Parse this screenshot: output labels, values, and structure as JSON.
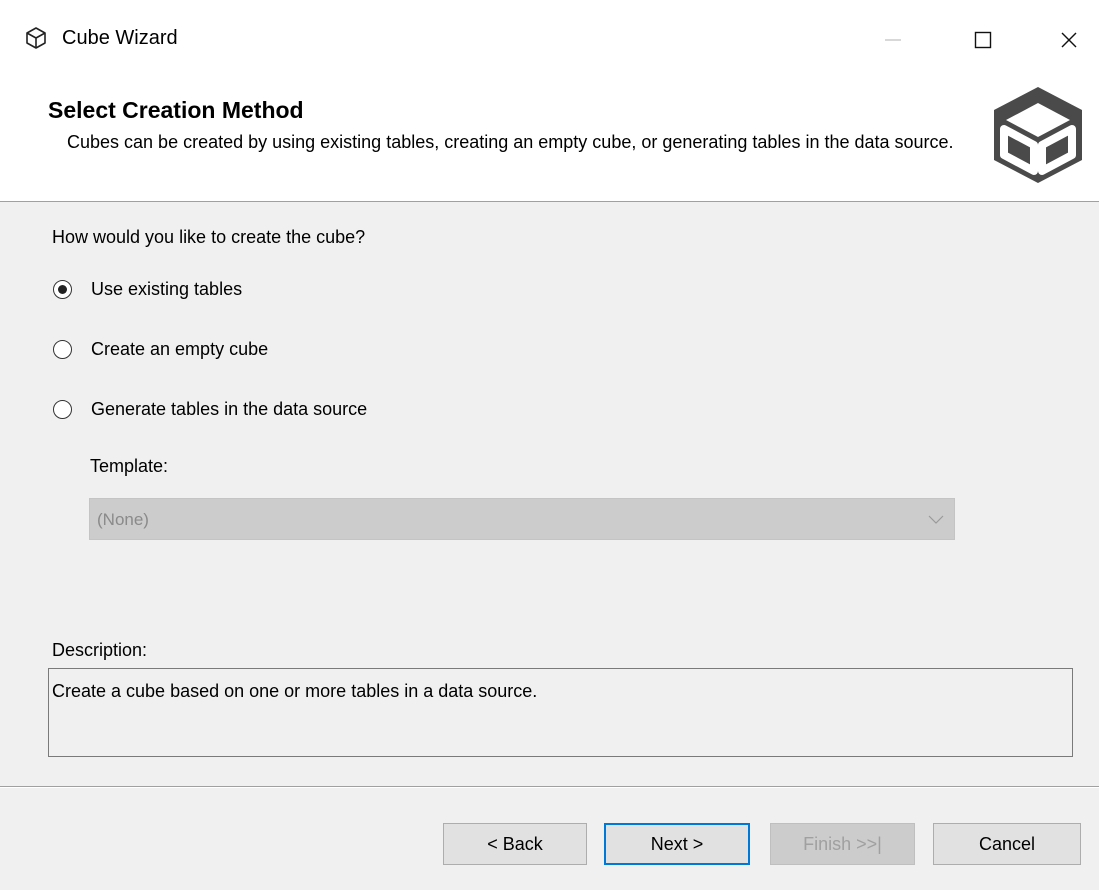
{
  "window": {
    "title": "Cube Wizard",
    "icon": "cube-icon"
  },
  "controls": {
    "minimize": "minimize-icon",
    "maximize": "maximize-icon",
    "close": "close-icon"
  },
  "header": {
    "title": "Select Creation Method",
    "description": "Cubes can be created by using existing tables, creating an empty cube, or generating tables in the data source.",
    "logo": "cube-logo-icon"
  },
  "form": {
    "question": "How would you like to create the cube?",
    "options": [
      {
        "label": "Use existing tables",
        "selected": true
      },
      {
        "label": "Create an empty cube",
        "selected": false
      },
      {
        "label": "Generate tables in the data source",
        "selected": false
      }
    ],
    "template_label": "Template:",
    "template_value": "(None)",
    "description_label": "Description:",
    "description_text": "Create a cube based on one or more tables in a data source."
  },
  "buttons": {
    "back": "< Back",
    "next": "Next >",
    "finish": "Finish >>|",
    "cancel": "Cancel"
  },
  "colors": {
    "accent": "#0078d7",
    "window_bg": "#f0f0f0",
    "header_bg": "#ffffff",
    "disabled_bg": "#cccccc",
    "logo": "#4a4a4a"
  }
}
